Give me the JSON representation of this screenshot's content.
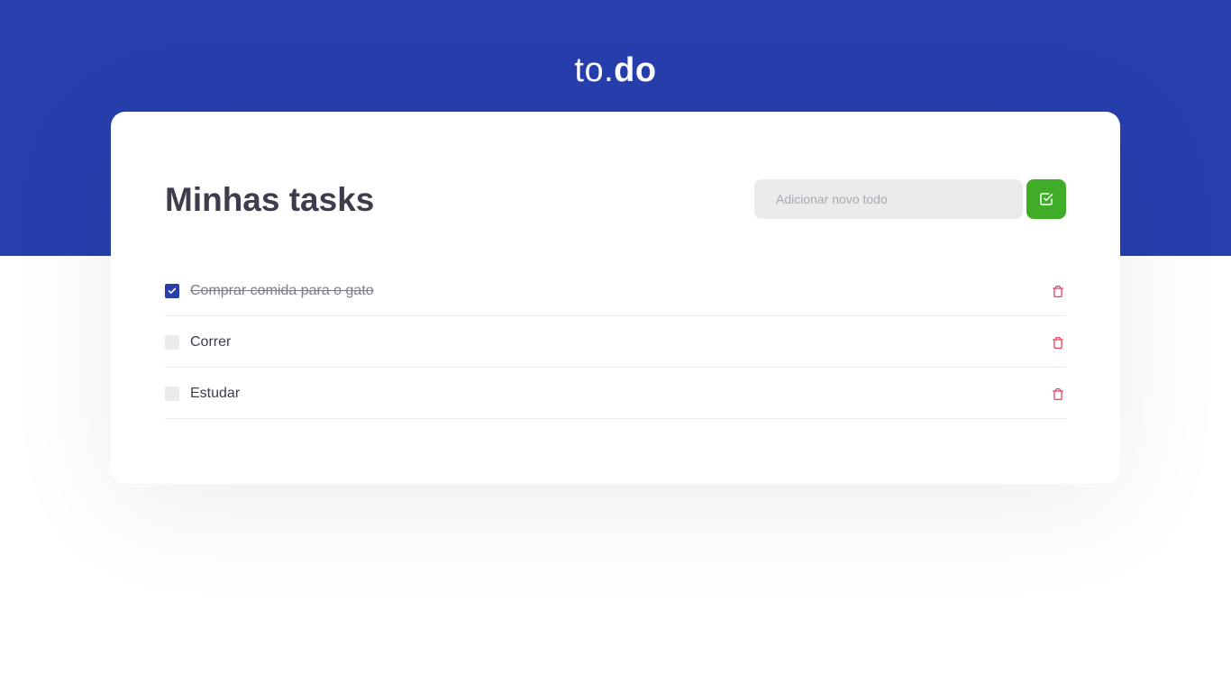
{
  "header": {
    "logo_light": "to.",
    "logo_bold": "do"
  },
  "main": {
    "title": "Minhas tasks",
    "new_task": {
      "placeholder": "Adicionar novo todo",
      "value": "",
      "add_icon": "check-square-icon"
    }
  },
  "tasks": [
    {
      "text": "Comprar comida para o gato",
      "done": true
    },
    {
      "text": "Correr",
      "done": false
    },
    {
      "text": "Estudar",
      "done": false
    }
  ],
  "colors": {
    "brand_blue": "#273FAD",
    "add_green": "#3FAD27",
    "delete_red": "#E83F5B",
    "title_text": "#3D3D4D",
    "input_bg": "#EBEBEB"
  }
}
